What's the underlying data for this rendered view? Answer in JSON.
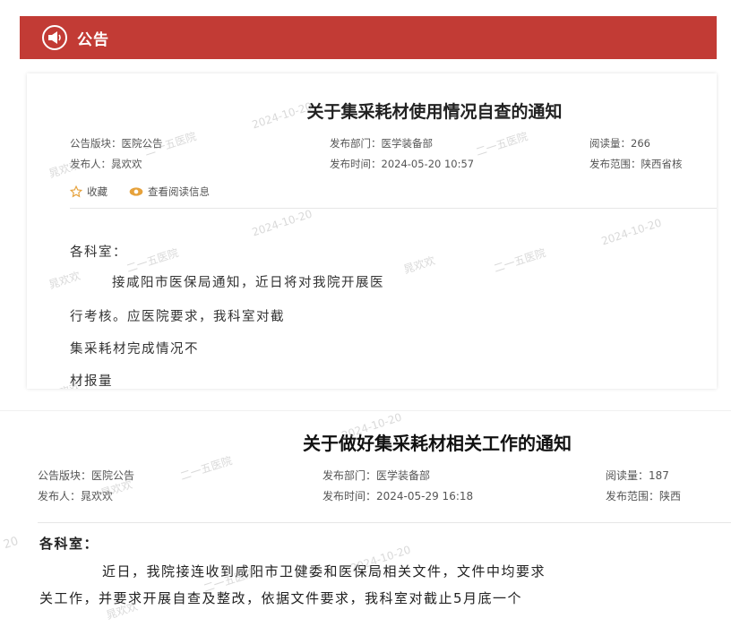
{
  "header": {
    "icon": "megaphone-icon",
    "title": "公告",
    "color": "#c23b35"
  },
  "notice1": {
    "title": "关于集采耗材使用情况自查的通知",
    "board": "公告版块：医院公告",
    "publisher": "发布人：晁欢欢",
    "department": "发布部门：医学装备部",
    "time": "发布时间：2024-05-20 10:57",
    "reads": "阅读量：266",
    "scope": "发布范围：陕西省核",
    "favorite_label": "收藏",
    "view_reads_label": "查看阅读信息",
    "greeting": "各科室：",
    "lines": [
      "接咸阳市医保局通知，近日将对我院开展医",
      "行考核。应医院要求，我科室对截",
      "集采耗材完成情况不",
      "材报量"
    ]
  },
  "notice2": {
    "title": "关于做好集采耗材相关工作的通知",
    "board": "公告版块：医院公告",
    "publisher": "发布人：晁欢欢",
    "department": "发布部门：医学装备部",
    "time": "发布时间：2024-05-29 16:18",
    "reads": "阅读量：187",
    "scope": "发布范围：陕西",
    "greeting": "各科室：",
    "lines": [
      "近日，我院接连收到咸阳市卫健委和医保局相关文件，文件中均要求",
      "关工作，并要求开展自查及整改，依据文件要求，我科室对截止5月底一个"
    ]
  },
  "watermark": {
    "date": "2024-10-20",
    "name": "晁欢欢",
    "org": "二一五医院",
    "partial": "20"
  }
}
